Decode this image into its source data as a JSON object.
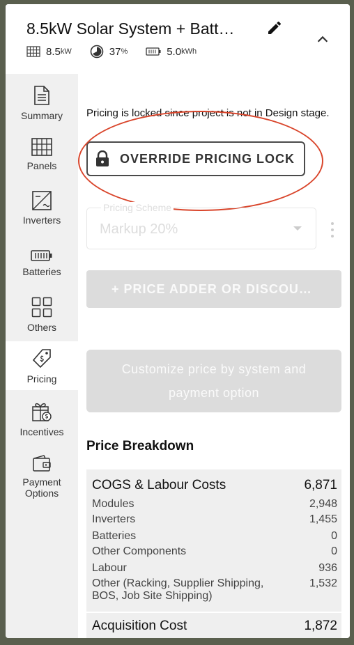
{
  "header": {
    "title": "8.5kW Solar System + Batt…",
    "stats": {
      "power_value": "8.5",
      "power_unit": "kW",
      "offset_value": "37",
      "offset_unit": "%",
      "battery_value": "5.0",
      "battery_unit": "kWh"
    }
  },
  "sidebar": {
    "items": [
      {
        "label": "Summary",
        "icon": "document-icon"
      },
      {
        "label": "Panels",
        "icon": "panels-grid-icon"
      },
      {
        "label": "Inverters",
        "icon": "inverter-icon"
      },
      {
        "label": "Batteries",
        "icon": "battery-icon"
      },
      {
        "label": "Others",
        "icon": "grid-squares-icon"
      },
      {
        "label": "Pricing",
        "icon": "price-tag-icon",
        "active": true
      },
      {
        "label": "Incentives",
        "icon": "gift-dollar-icon"
      },
      {
        "label": "Payment",
        "label2": "Options",
        "icon": "wallet-icon"
      }
    ]
  },
  "pricing": {
    "locked_note": "Pricing is locked since project is not in Design stage.",
    "override_label": "OVERRIDE PRICING LOCK",
    "scheme_label": "Pricing Scheme",
    "scheme_value": "Markup 20%",
    "adder_label": "+ PRICE ADDER OR DISCOU…",
    "customize_line1": "Customize price by system and",
    "customize_line2": "payment option"
  },
  "breakdown": {
    "title": "Price Breakdown",
    "cogs_label": "COGS & Labour Costs",
    "cogs_value": "6,871",
    "rows": [
      {
        "label": "Modules",
        "value": "2,948"
      },
      {
        "label": "Inverters",
        "value": "1,455"
      },
      {
        "label": "Batteries",
        "value": "0"
      },
      {
        "label": "Other Components",
        "value": "0"
      },
      {
        "label": "Labour",
        "value": "936"
      },
      {
        "label": "Other (Racking, Supplier Shipping,",
        "label2": "BOS, Job Site Shipping)",
        "value": "1,532"
      }
    ],
    "acq_label": "Acquisition Cost",
    "acq_value": "1,872"
  },
  "colors": {
    "highlight": "#d9452b",
    "disabled_bg": "#dcdcdc"
  }
}
